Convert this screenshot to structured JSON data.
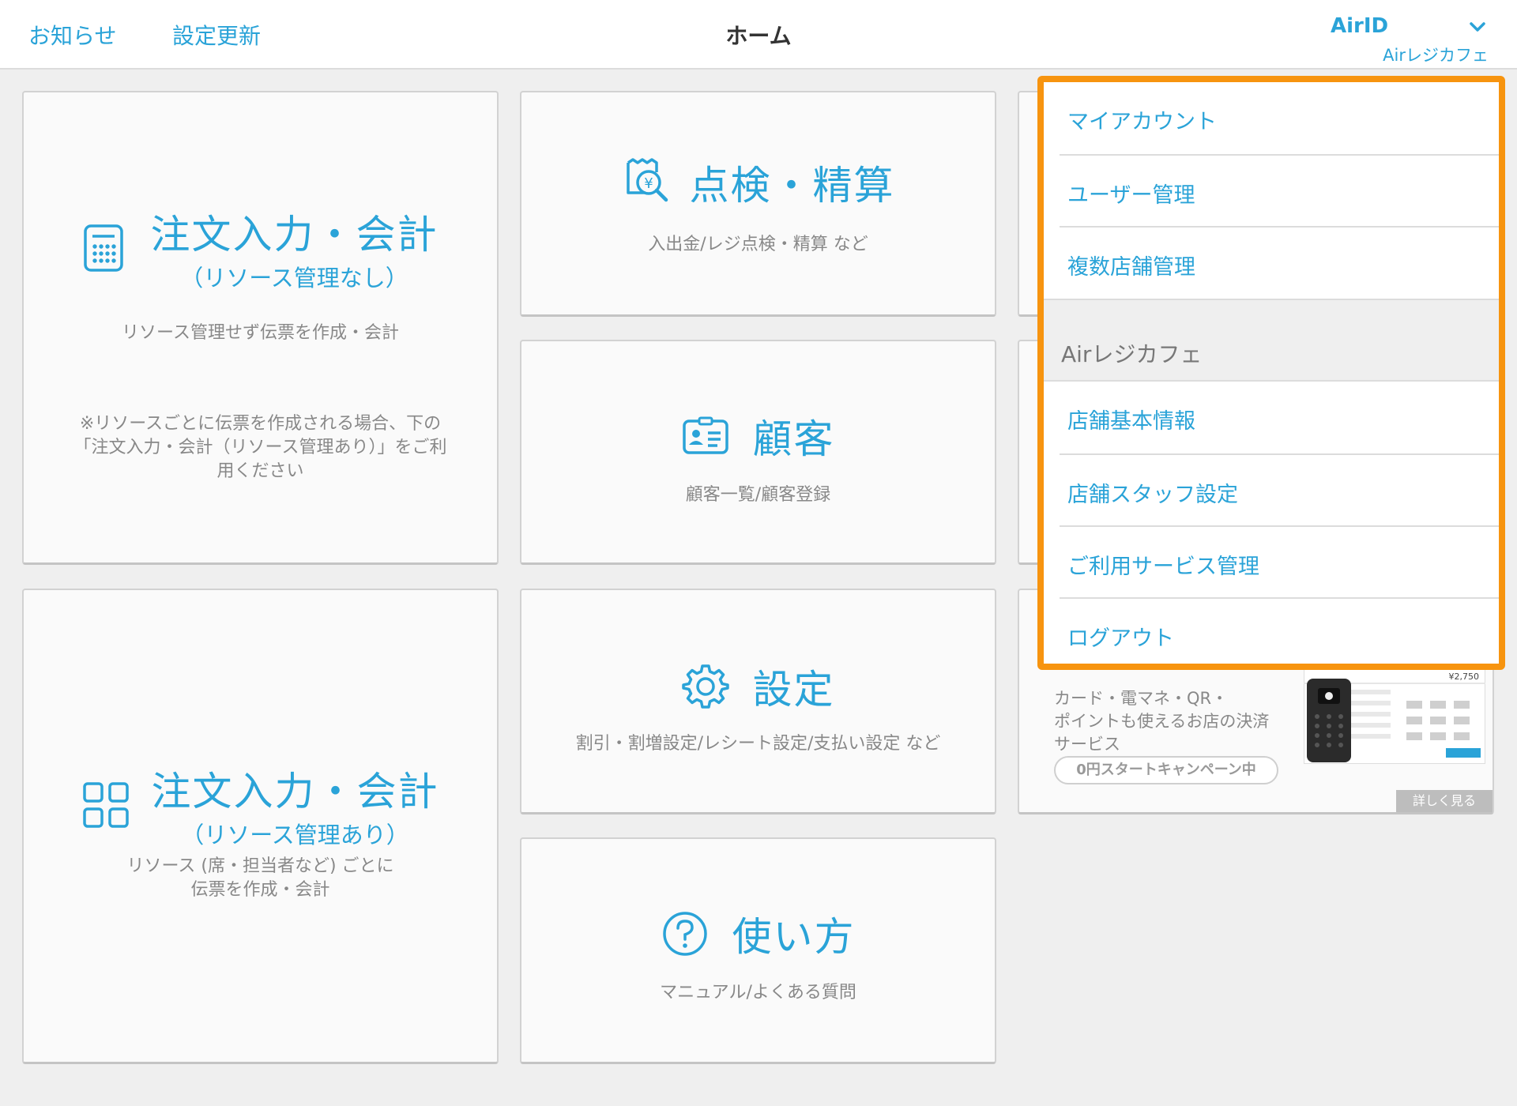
{
  "header": {
    "notice_link": "お知らせ",
    "settings_update_link": "設定更新",
    "title": "ホーム",
    "airid": "AirID",
    "store_name": "Airレジカフェ"
  },
  "tiles": {
    "order_no_resource": {
      "title": "注文入力・会計",
      "subtitle": "（リソース管理なし）",
      "desc": "リソース管理せず伝票を作成・会計",
      "note_1": "※リソースごとに伝票を作成される場合、下の",
      "note_2": "「注文入力・会計（リソース管理あり）」をご利",
      "note_3": "用ください"
    },
    "inspection": {
      "title": "点検・精算",
      "desc": "入出金/レジ点検・精算 など"
    },
    "customer": {
      "title": "顧客",
      "desc": "顧客一覧/顧客登録"
    },
    "settings": {
      "title": "設定",
      "desc": "割引・割増設定/レシート設定/支払い設定 など"
    },
    "order_with_resource": {
      "title": "注文入力・会計",
      "subtitle": "（リソース管理あり）",
      "desc_1": "リソース (席・担当者など) ごとに",
      "desc_2": "伝票を作成・会計"
    },
    "howto": {
      "title": "使い方",
      "desc": "マニュアル/よくある質問"
    }
  },
  "menu": {
    "items_account": [
      "マイアカウント",
      "ユーザー管理",
      "複数店舗管理"
    ],
    "section_label": "Airレジカフェ",
    "items_store": [
      "店舗基本情報",
      "店舗スタッフ設定",
      "ご利用サービス管理",
      "ログアウト"
    ]
  },
  "ad": {
    "text_1": "カード・電マネ・QR・",
    "text_2": "ポイントも使えるお店の決済",
    "text_3": "サービス",
    "campaign": "0円スタートキャンペーン中",
    "more": "詳しく見る",
    "price": "¥2,750"
  },
  "colors": {
    "accent": "#2aa3d8",
    "highlight_border": "#f7940f"
  }
}
